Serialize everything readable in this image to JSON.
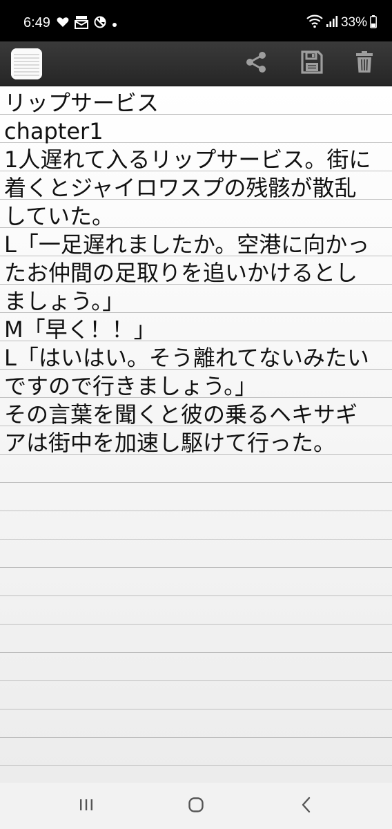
{
  "status_bar": {
    "time": "6:49",
    "battery": "33%",
    "icons": [
      "heart-icon",
      "mail-notification-icon",
      "no-disturb-icon",
      "dot-icon",
      "wifi-icon",
      "signal-icon",
      "battery-icon"
    ]
  },
  "toolbar": {
    "app_icon": "notepad-icon",
    "actions": [
      "share-icon",
      "save-icon",
      "trash-icon"
    ],
    "background": "#2e2e2e"
  },
  "note": {
    "lines": [
      "リップサービス",
      "chapter1",
      "1人遅れて入るリップサービス。街に",
      "着くとジャイロワスプの残骸が散乱",
      "していた。",
      "L「一足遅れましたか。空港に向かっ",
      "たお仲間の足取りを追いかけるとし",
      "ましょう。」",
      "M「早く！！」",
      "L「はいはい。そう離れてないみたい",
      "ですので行きましょう。」",
      "その言葉を聞くと彼の乗るヘキサギ",
      "アは街中を加速し駆けて行った。"
    ],
    "rule_color": "#bdbdbd"
  },
  "nav_bar": {
    "buttons": [
      "recents-icon",
      "home-icon",
      "back-icon"
    ]
  }
}
